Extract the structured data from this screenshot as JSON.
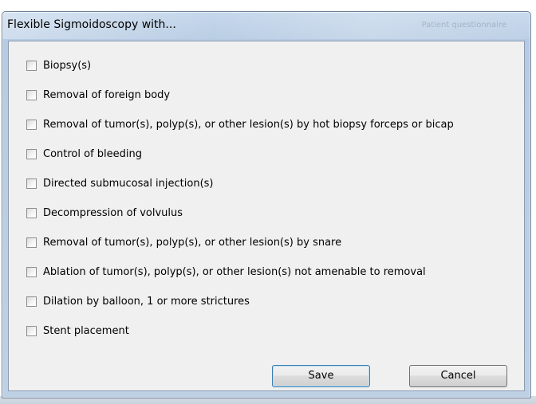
{
  "dialog": {
    "title": "Flexible Sigmoidoscopy with...",
    "background_title_hint": "Patient questionnaire",
    "options": [
      {
        "label": "Biopsy(s)",
        "checked": false
      },
      {
        "label": "Removal of foreign body",
        "checked": false
      },
      {
        "label": "Removal of tumor(s), polyp(s), or other lesion(s) by hot biopsy forceps or bicap",
        "checked": false
      },
      {
        "label": "Control of bleeding",
        "checked": false
      },
      {
        "label": "Directed submucosal injection(s)",
        "checked": false
      },
      {
        "label": "Decompression of volvulus",
        "checked": false
      },
      {
        "label": "Removal of tumor(s), polyp(s), or other lesion(s) by snare",
        "checked": false
      },
      {
        "label": "Ablation of tumor(s), polyp(s), or other lesion(s) not amenable to removal",
        "checked": false
      },
      {
        "label": "Dilation by balloon, 1 or more strictures",
        "checked": false
      },
      {
        "label": "Stent placement",
        "checked": false
      }
    ],
    "buttons": {
      "save_label": "Save",
      "cancel_label": "Cancel"
    }
  },
  "colors": {
    "frame": "#b6cbe3",
    "client": "#f0f0f0",
    "default_button_border": "#3c7fb1"
  }
}
